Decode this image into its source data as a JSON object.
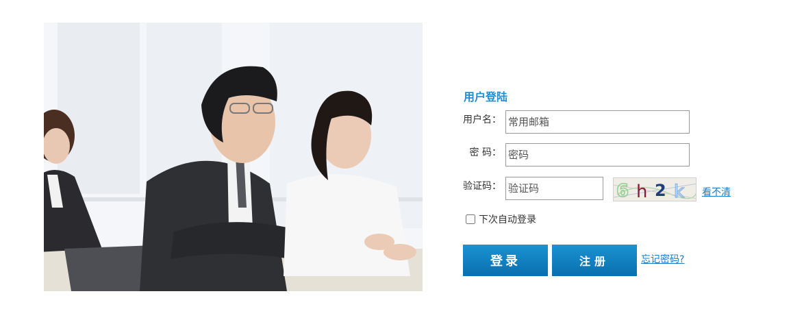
{
  "login": {
    "title": "用户登陆",
    "username_label": "用户名：",
    "username_placeholder": "常用邮箱",
    "password_label": "密 码：",
    "password_placeholder": "密码",
    "captcha_label": "验证码：",
    "captcha_placeholder": "验证码",
    "captcha_text": "6h2k",
    "refresh_captcha_link": "看不清",
    "remember_label": "下次自动登录",
    "remember_checked": false,
    "login_button": "登录",
    "register_button": "注册",
    "forgot_password_link": "忘记密码?"
  },
  "colors": {
    "title": "#1d8fd8",
    "button": "#0a7cbf",
    "link": "#1a7cc9"
  }
}
